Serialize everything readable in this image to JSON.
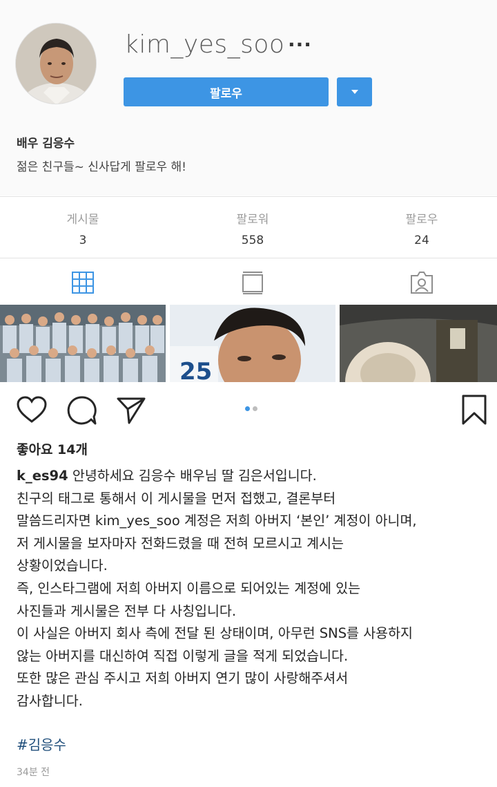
{
  "profile": {
    "username": "kim_yes_soo",
    "more_label": "···",
    "follow_label": "팔로우",
    "bio_name": "배우 김응수",
    "bio_text": "젊은 친구들~ 신사답게 팔로우 해!"
  },
  "stats": [
    {
      "label": "게시물",
      "value": "3"
    },
    {
      "label": "팔로워",
      "value": "558"
    },
    {
      "label": "팔로우",
      "value": "24"
    }
  ],
  "tabs": [
    "grid-icon",
    "feed-icon",
    "tagged-icon"
  ],
  "colors": {
    "accent": "#3d95e4",
    "hashtag": "#1e4d7a",
    "muted": "#9b9b9b"
  },
  "post": {
    "likes": "좋아요 14개",
    "author": "k_es94",
    "caption_lines": [
      "안녕하세요 김응수 배우님 딸 김은서입니다.",
      "친구의 태그로 통해서 이 게시물을 먼저 접했고, 결론부터",
      "말씀드리자면 kim_yes_soo 계정은 저희 아버지 ‘본인’ 계정이 아니며,",
      "저 게시물을 보자마자 전화드렸을 때 전혀 모르시고 계시는",
      "상황이었습니다.",
      "즉, 인스타그램에 저희 아버지 이름으로 되어있는 계정에 있는",
      "사진들과 게시물은 전부 다 사칭입니다.",
      "이 사실은 아버지 회사 측에 전달 된 상태이며, 아무런 SNS를 사용하지",
      "않는 아버지를 대신하여 직접 이렇게 글을 적게 되었습니다.",
      "또한 많은 관심 주시고 저희 아버지 연기 많이 사랑해주셔서",
      "감사합니다."
    ],
    "hashtag": "#김응수",
    "timestamp": "34분 전",
    "banner_text": "25"
  }
}
